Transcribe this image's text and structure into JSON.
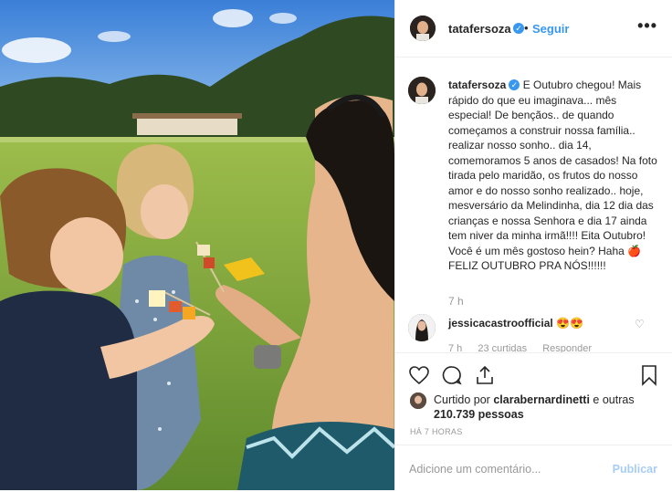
{
  "header": {
    "username": "tatafersoza",
    "verified_mark": "✓",
    "separator": "•",
    "follow_label": "Seguir",
    "more_label": "•••"
  },
  "caption": {
    "username": "tatafersoza",
    "verified_mark": "✓",
    "text": "E Outubro chegou! Mais rápido do que eu imaginava... mês especial! De bençãos.. de quando começamos a construir nossa família.. realizar nosso sonho.. dia 14, comemoramos 5 anos de casados! Na foto tirada pelo maridão, os frutos do nosso amor e do nosso sonho realizado.. hoje, mesversário da Melindinha, dia 12 dia das crianças e nossa Senhora e dia 17 ainda tem niver da minha irmã!!!! Eita Outubro! Você é um mês gostoso hein? Haha 🍎 FELIZ OUTUBRO PRA NÓS!!!!!!",
    "time": "7 h"
  },
  "comment": {
    "username": "jessicacastroofficial",
    "text": "😍😍",
    "time": "7 h",
    "likes": "23 curtidas",
    "reply": "Responder"
  },
  "likes": {
    "prefix": "Curtido por",
    "user": "clarabernardinetti",
    "middle": "e outras",
    "count": "210.739 pessoas"
  },
  "time_ago": "HÁ 7 HORAS",
  "add_comment": {
    "placeholder": "Adicione um comentário...",
    "post_label": "Publicar"
  },
  "icons": [
    "heart-icon",
    "comment-icon",
    "share-icon",
    "bookmark-icon",
    "more-icon"
  ]
}
